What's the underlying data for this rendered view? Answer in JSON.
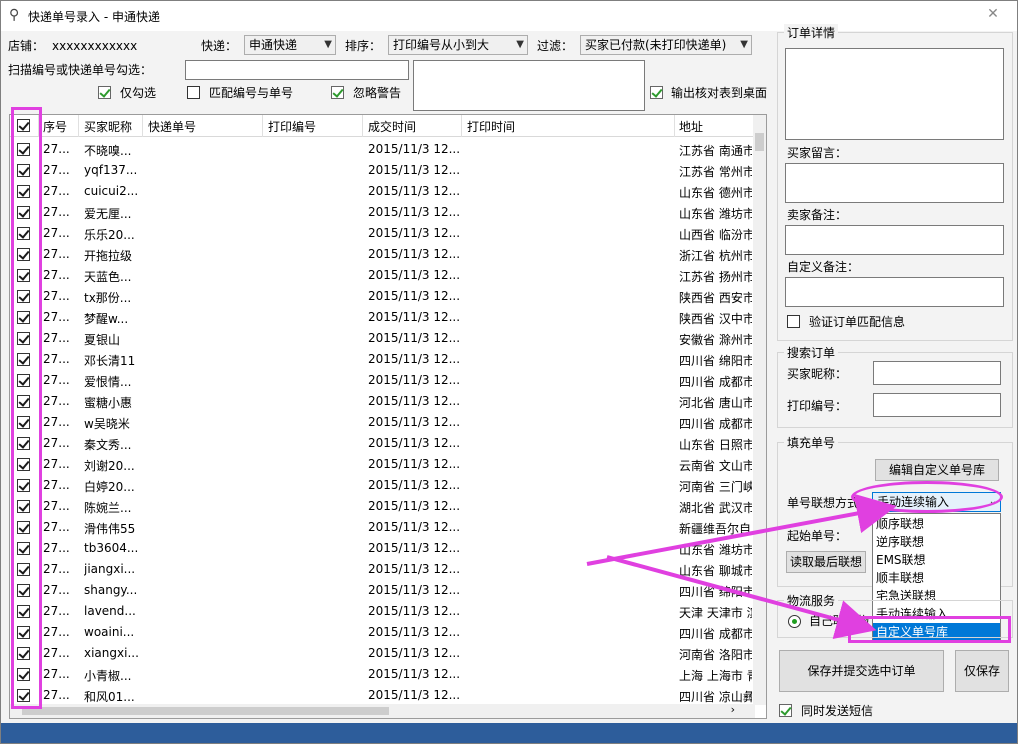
{
  "window": {
    "title": "快递单号录入 - 申通快递"
  },
  "toolbar": {
    "shop_label": "店铺：",
    "shop_value": "xxxxxxxxxxxx",
    "express_label": "快递：",
    "express_value": "申通快递",
    "sort_label": "排序：",
    "sort_value": "打印编号从小到大",
    "filter_label": "过滤：",
    "filter_value": "买家已付款(未打印快递单)",
    "scan_label": "扫描编号或快递单号勾选：",
    "only_checked": "仅勾选",
    "match_number": "匹配编号与单号",
    "ignore_warning": "忽略警告",
    "export_check": "输出核对表到桌面"
  },
  "grid": {
    "headers": [
      "序号",
      "买家昵称",
      "快递单号",
      "打印编号",
      "成交时间",
      "打印时间",
      "地址"
    ],
    "rows": [
      [
        "27...",
        "不晓嗅...",
        "2015/11/3 12...",
        "江苏省 南通市"
      ],
      [
        "27...",
        "yqf137...",
        "2015/11/3 12...",
        "江苏省 常州市"
      ],
      [
        "27...",
        "cuicui2...",
        "2015/11/3 12...",
        "山东省 德州市"
      ],
      [
        "27...",
        "爱无厘...",
        "2015/11/3 12...",
        "山东省 潍坊市"
      ],
      [
        "27...",
        "乐乐20...",
        "2015/11/3 12...",
        "山西省 临汾市"
      ],
      [
        "27...",
        "开拖拉级",
        "2015/11/3 12...",
        "浙江省 杭州市"
      ],
      [
        "27...",
        "天蓝色...",
        "2015/11/3 12...",
        "江苏省 扬州市"
      ],
      [
        "27...",
        "tx那份...",
        "2015/11/3 12...",
        "陕西省 西安市"
      ],
      [
        "27...",
        "梦醒w...",
        "2015/11/3 12...",
        "陕西省 汉中市"
      ],
      [
        "27...",
        "夏银山",
        "2015/11/3 12...",
        "安徽省 滁州市"
      ],
      [
        "27...",
        "邓长清11",
        "2015/11/3 12...",
        "四川省 绵阳市"
      ],
      [
        "27...",
        "爱恨情...",
        "2015/11/3 12...",
        "四川省 成都市"
      ],
      [
        "27...",
        "蜜糖小惠",
        "2015/11/3 12...",
        "河北省 唐山市"
      ],
      [
        "27...",
        "w吴晓米",
        "2015/11/3 12...",
        "四川省 成都市"
      ],
      [
        "27...",
        "秦文秀...",
        "2015/11/3 12...",
        "山东省 日照市"
      ],
      [
        "27...",
        "刘谢20...",
        "2015/11/3 12...",
        "云南省 文山市"
      ],
      [
        "27...",
        "白婷20...",
        "2015/11/3 12...",
        "河南省 三门峡"
      ],
      [
        "27...",
        "陈婉兰...",
        "2015/11/3 12...",
        "湖北省 武汉市"
      ],
      [
        "27...",
        "滑伟伟55",
        "2015/11/3 12...",
        "新疆维吾尔自"
      ],
      [
        "27...",
        "tb3604...",
        "2015/11/3 12...",
        "山东省 潍坊市"
      ],
      [
        "27...",
        "jiangxi...",
        "2015/11/3 12...",
        "山东省 聊城市"
      ],
      [
        "27...",
        "shangy...",
        "2015/11/3 12...",
        "四川省 绵阳市"
      ],
      [
        "27...",
        "lavend...",
        "2015/11/3 12...",
        "天津 天津市 滨"
      ],
      [
        "27...",
        "woaini...",
        "2015/11/3 12...",
        "四川省 成都市"
      ],
      [
        "27...",
        "xiangxi...",
        "2015/11/3 12...",
        "河南省 洛阳市"
      ],
      [
        "27...",
        "小青椒...",
        "2015/11/3 12...",
        "上海 上海市 青"
      ],
      [
        "27...",
        "和风01...",
        "2015/11/3 12...",
        "四川省 凉山彝"
      ]
    ]
  },
  "order_detail": {
    "title": "订单详情",
    "buyer_msg": "买家留言：",
    "seller_note": "卖家备注：",
    "custom_note": "自定义备注：",
    "verify_match": "验证订单匹配信息"
  },
  "search": {
    "title": "搜索订单",
    "buyer_nick": "买家昵称：",
    "print_no": "打印编号："
  },
  "fill": {
    "title": "填充单号",
    "edit_custom_btn": "编辑自定义单号库",
    "assoc_label": "单号联想方式",
    "assoc_value": "手动连续输入",
    "start_label": "起始单号：",
    "read_last_btn": "读取最后联想",
    "options": [
      "顺序联想",
      "逆序联想",
      "EMS联想",
      "顺丰联想",
      "宅急送联想",
      "手动连续输入",
      "自定义单号库"
    ]
  },
  "logistics": {
    "title": "物流服务",
    "radio_label": "自己联系物流"
  },
  "actions": {
    "save_submit": "保存并提交选中订单",
    "save_only": "仅保存",
    "send_sms": "同时发送短信"
  },
  "colors": {
    "highlight": "#e040e0",
    "selection": "#0078d7",
    "statusbar": "#2d5d9b"
  }
}
